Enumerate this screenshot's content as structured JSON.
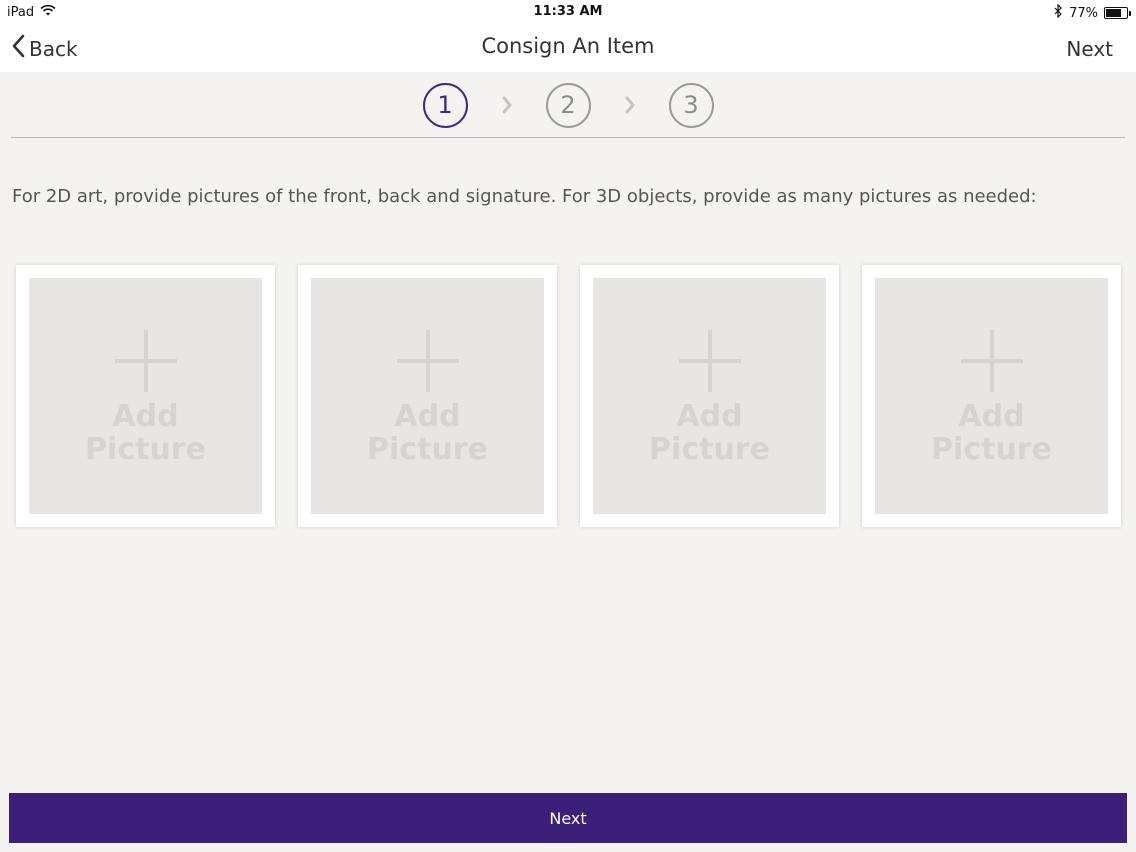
{
  "status_bar": {
    "device": "iPad",
    "time": "11:33 AM",
    "battery_percent": "77%",
    "battery_level": 0.77
  },
  "nav": {
    "back_label": "Back",
    "title": "Consign An Item",
    "next_label": "Next"
  },
  "steps": [
    {
      "number": "1",
      "active": true
    },
    {
      "number": "2",
      "active": false
    },
    {
      "number": "3",
      "active": false
    }
  ],
  "instructions": "For 2D art, provide pictures of the front, back and signature.  For 3D objects, provide as many pictures as needed:",
  "pictures": [
    {
      "label": "Add\nPicture"
    },
    {
      "label": "Add\nPicture"
    },
    {
      "label": "Add\nPicture"
    },
    {
      "label": "Add\nPicture"
    }
  ],
  "bottom_button": {
    "label": "Next",
    "color": "#3c1f78"
  },
  "icons": {
    "wifi": "wifi-icon",
    "bluetooth": "bluetooth-icon",
    "battery": "battery-icon",
    "back": "chevron-left-icon",
    "step_arrow": "chevron-right-icon",
    "add": "plus-icon"
  }
}
